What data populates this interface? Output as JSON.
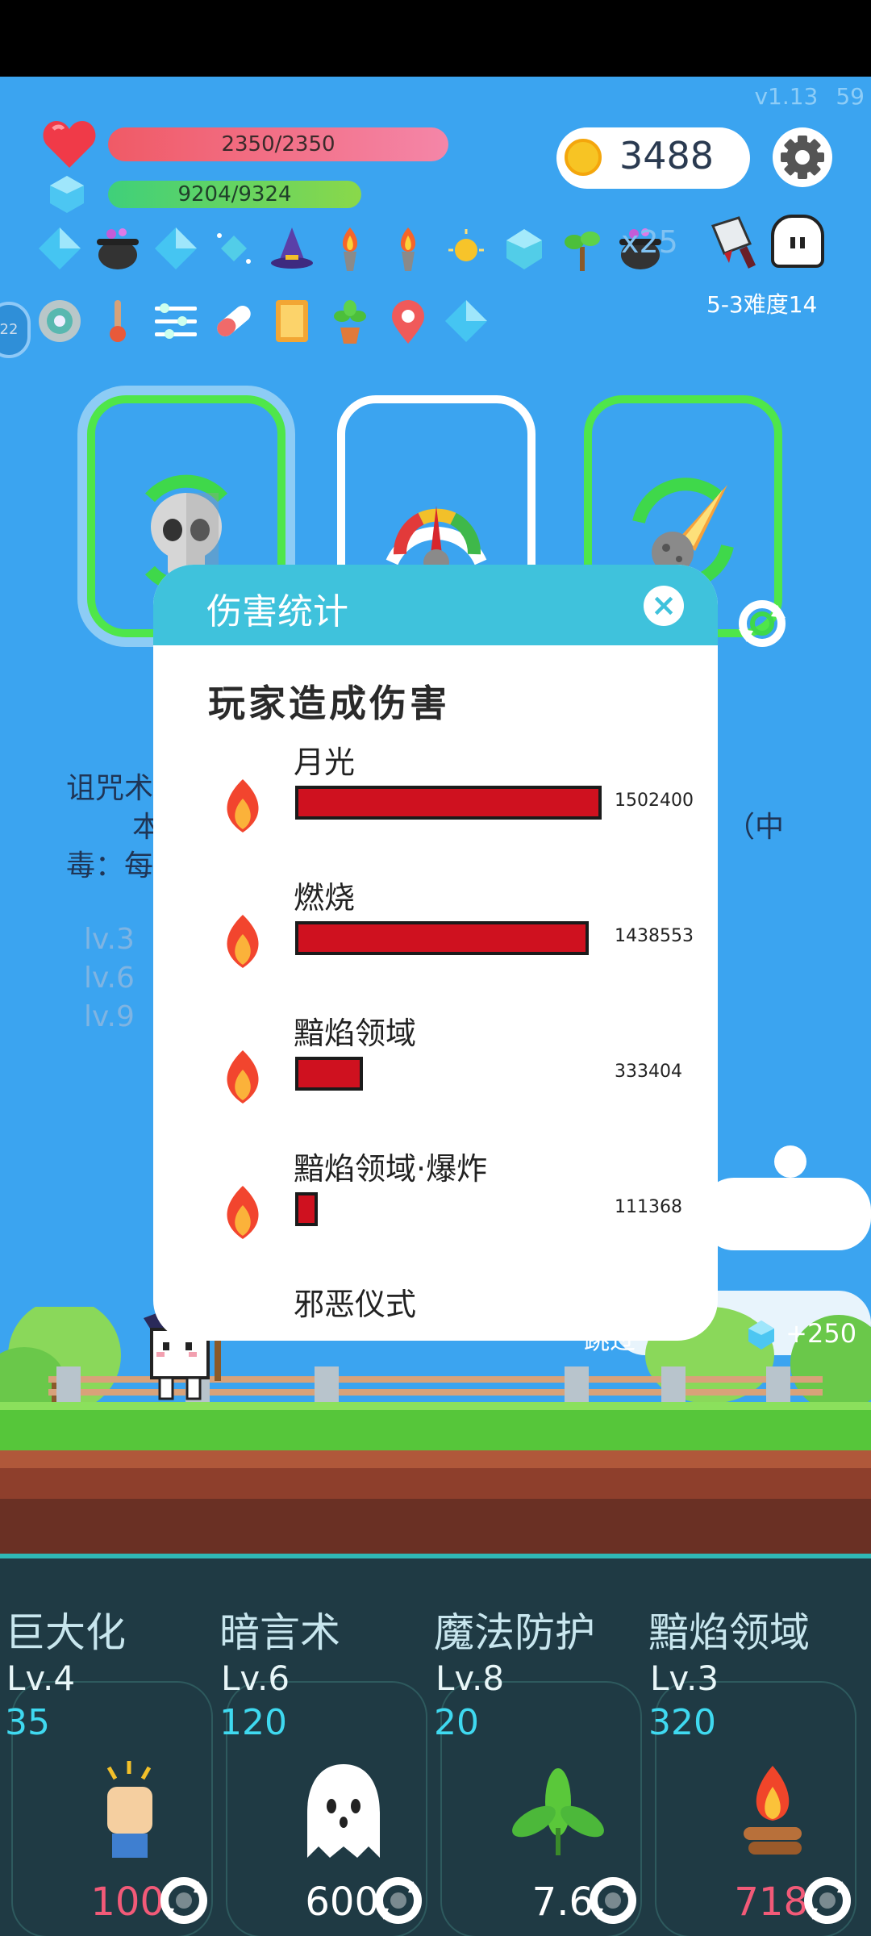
{
  "hud": {
    "version": "v1.13",
    "fps": "59",
    "hp_text": "2350/2350",
    "mana_text": "9204/9324",
    "coins": "3488",
    "hidden_count": "x25",
    "stage_label": "5-3难度14",
    "round_badge": "22",
    "icons_row1": [
      "diamond-icon",
      "cauldron-icon",
      "diamond-icon",
      "sparkle-gem-icon",
      "wizard-hat-icon",
      "torch-icon",
      "torch-icon",
      "sun-orb-icon",
      "ice-crystal-icon",
      "sapling-icon",
      "cauldron-icon"
    ],
    "icons_row2": [
      "target-disc-icon",
      "thermometer-icon",
      "sliders-icon",
      "pill-icon",
      "book-icon",
      "potted-plant-icon",
      "map-pin-icon",
      "diamond-icon"
    ]
  },
  "cards": [
    {
      "name": "skull-card",
      "selected": true
    },
    {
      "name": "gauge-card",
      "selected": false
    },
    {
      "name": "meteor-card",
      "selected": false
    }
  ],
  "background_desc": {
    "line1": "诅咒术",
    "line2": "本",
    "line2_right": "（中",
    "line3": "毒：每",
    "lv_lines": [
      "lv.3",
      "lv.6",
      "lv.9"
    ]
  },
  "scene": {
    "skip_label": "跳过",
    "gem_reward": "+250"
  },
  "damage_panel": {
    "title": "伤害统计",
    "close": "×",
    "subtitle": "玩家造成伤害",
    "rows": [
      {
        "name": "月光",
        "value": 1502400,
        "value_label": "1502400"
      },
      {
        "name": "燃烧",
        "value": 1438553,
        "value_label": "1438553"
      },
      {
        "name": "黯焰领域",
        "value": 333404,
        "value_label": "333404"
      },
      {
        "name": "黯焰领域·爆炸",
        "value": 111368,
        "value_label": "111368"
      },
      {
        "name": "邪恶仪式",
        "value": null,
        "value_label": ""
      }
    ]
  },
  "skills": [
    {
      "name": "巨大化",
      "level": "Lv.4",
      "cost": "35",
      "value": "100",
      "value_color": "red",
      "icon": "fist-icon"
    },
    {
      "name": "暗言术",
      "level": "Lv.6",
      "cost": "120",
      "value": "600",
      "value_color": "white",
      "icon": "ghost-icon"
    },
    {
      "name": "魔法防护",
      "level": "Lv.8",
      "cost": "20",
      "value": "7.6",
      "value_color": "white",
      "icon": "leaf-icon"
    },
    {
      "name": "黯焰领域",
      "level": "Lv.3",
      "cost": "320",
      "value": "718",
      "value_color": "red",
      "icon": "campfire-icon"
    }
  ],
  "colors": {
    "sky": "#3ba4f0",
    "accent_cyan": "#3fc2dc",
    "damage_bar": "#cf111f",
    "hp": "#f05a66",
    "mana": "#3fd07a"
  }
}
